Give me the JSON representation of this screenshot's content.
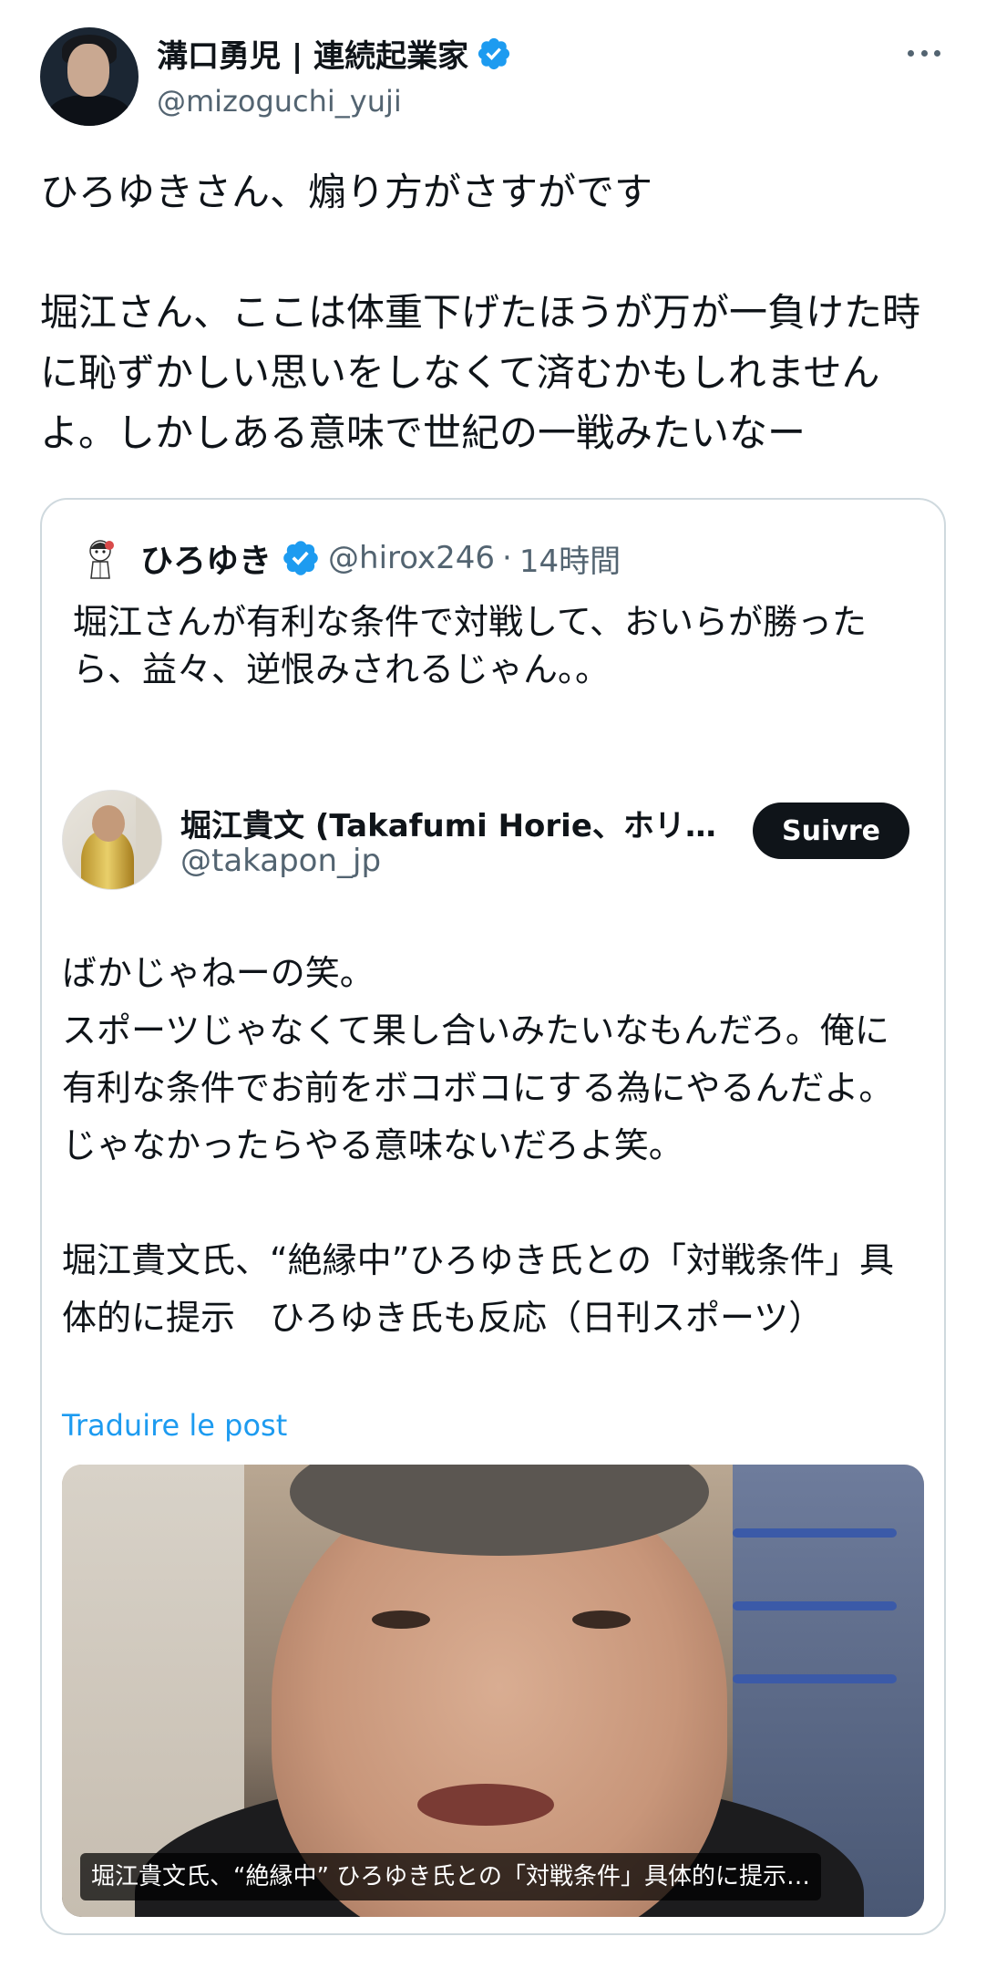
{
  "post": {
    "author_name": "溝口勇児 | 連続起業家",
    "author_handle": "@mizoguchi_yuji",
    "text": "ひろゆきさん、煽り方がさすがです\n\n堀江さん、ここは体重下げたほうが万が一負けた時に恥ずかしい思いをしなくて済むかもしれませんよ。しかしある意味で世紀の一戦みたいなー"
  },
  "quote": {
    "author_name": "ひろゆき",
    "author_handle": "@hirox246",
    "separator": "·",
    "time": "14時間",
    "text": "堀江さんが有利な条件で対戦して、おいらが勝ったら、益々、逆恨みされるじゃん。。"
  },
  "embedded": {
    "author_name": "堀江貴文 (Takafumi Horie、ホリエ...",
    "author_handle": "@takapon_jp",
    "follow_label": "Suivre",
    "text": "ばかじゃねーの笑。\nスポーツじゃなくて果し合いみたいなもんだろ。俺に有利な条件でお前をボコボコにする為にやるんだよ。じゃなかったらやる意味ないだろよ笑。\n\n堀江貴文氏、“絶縁中”ひろゆき氏との「対戦条件」具体的に提示　ひろゆき氏も反応（日刊スポーツ）",
    "translate_label": "Traduire le post",
    "media_caption": "堀江貴文氏、“絶縁中” ひろゆき氏との「対戦条件」具体的に提示…"
  },
  "colors": {
    "text": "#0f1419",
    "secondary": "#536471",
    "link": "#1d9bf0",
    "verified": "#1d9bf0",
    "border": "#cfd9de",
    "button_bg": "#0f1419"
  },
  "icons": {
    "verified": "verified-badge-icon",
    "more": "more-options-icon"
  }
}
